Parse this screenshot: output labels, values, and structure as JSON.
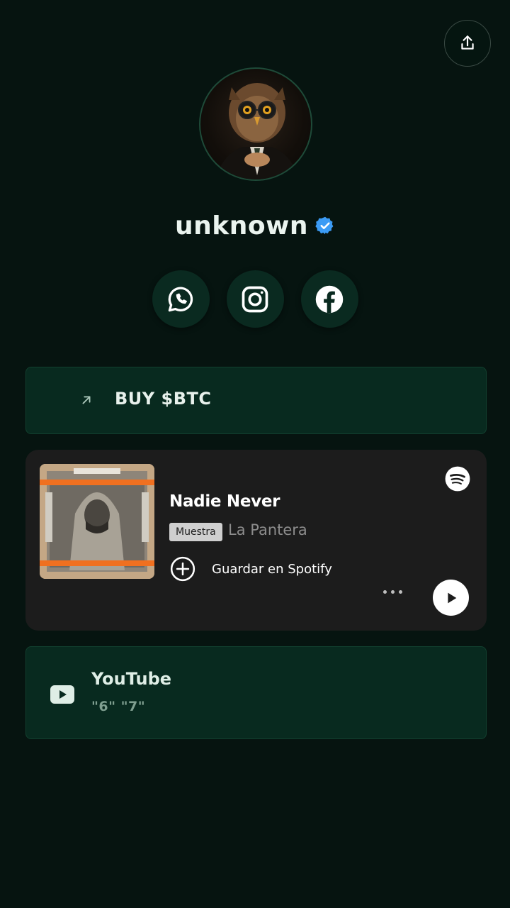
{
  "profile": {
    "name": "unknown",
    "verified": true
  },
  "socials": [
    {
      "icon": "whatsapp-icon"
    },
    {
      "icon": "instagram-icon"
    },
    {
      "icon": "facebook-icon"
    }
  ],
  "links": {
    "btc": {
      "label": "BUY $BTC",
      "icon": "arrow-up-right-icon"
    },
    "youtube": {
      "title": "YouTube",
      "subtitle": "\"6\" \"7\"",
      "icon": "youtube-icon"
    }
  },
  "spotify": {
    "track": "Nadie Never",
    "badge": "Muestra",
    "artist": "La Pantera",
    "save_label": "Guardar en Spotify"
  },
  "colors": {
    "background": "#061410",
    "card": "#082a1f",
    "spotify_card": "#1c1c1c",
    "verified": "#3b9bf5"
  }
}
